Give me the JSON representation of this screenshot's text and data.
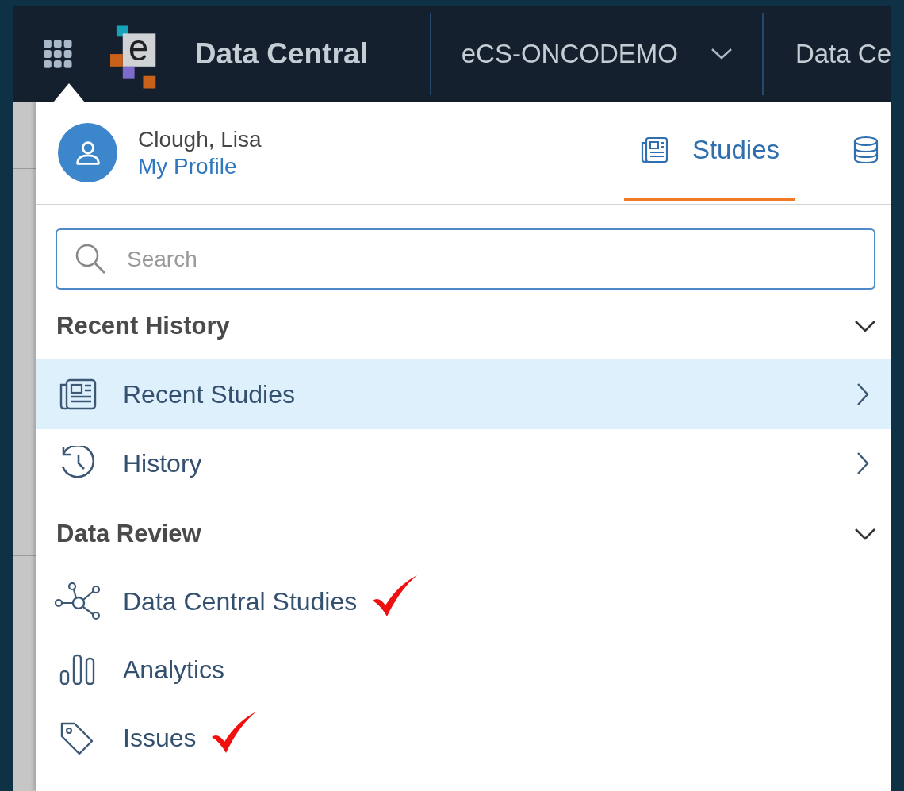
{
  "topbar": {
    "logo_letter": "e",
    "app_title": "Data Central",
    "environment": "eCS-ONCODEMO",
    "next_item": "Data Ce"
  },
  "profile": {
    "name": "Clough, Lisa",
    "link": "My Profile"
  },
  "tabs": [
    {
      "kind": "studies",
      "label": "Studies",
      "selected": true
    },
    {
      "kind": "database",
      "selected": false
    }
  ],
  "search": {
    "placeholder": "Search"
  },
  "sections": [
    {
      "title": "Recent History",
      "expanded": true,
      "items": [
        {
          "kind": "newspaper",
          "label": "Recent Studies",
          "selected": true,
          "submenu": true,
          "annotated": false
        },
        {
          "kind": "history",
          "label": "History",
          "selected": false,
          "submenu": true,
          "annotated": false
        }
      ]
    },
    {
      "title": "Data Review",
      "expanded": true,
      "items": [
        {
          "kind": "network",
          "label": "Data Central Studies",
          "selected": false,
          "submenu": false,
          "annotated": true
        },
        {
          "kind": "bars",
          "label": "Analytics",
          "selected": false,
          "submenu": false,
          "annotated": false
        },
        {
          "kind": "tag",
          "label": "Issues",
          "selected": false,
          "submenu": false,
          "annotated": true
        }
      ]
    }
  ]
}
